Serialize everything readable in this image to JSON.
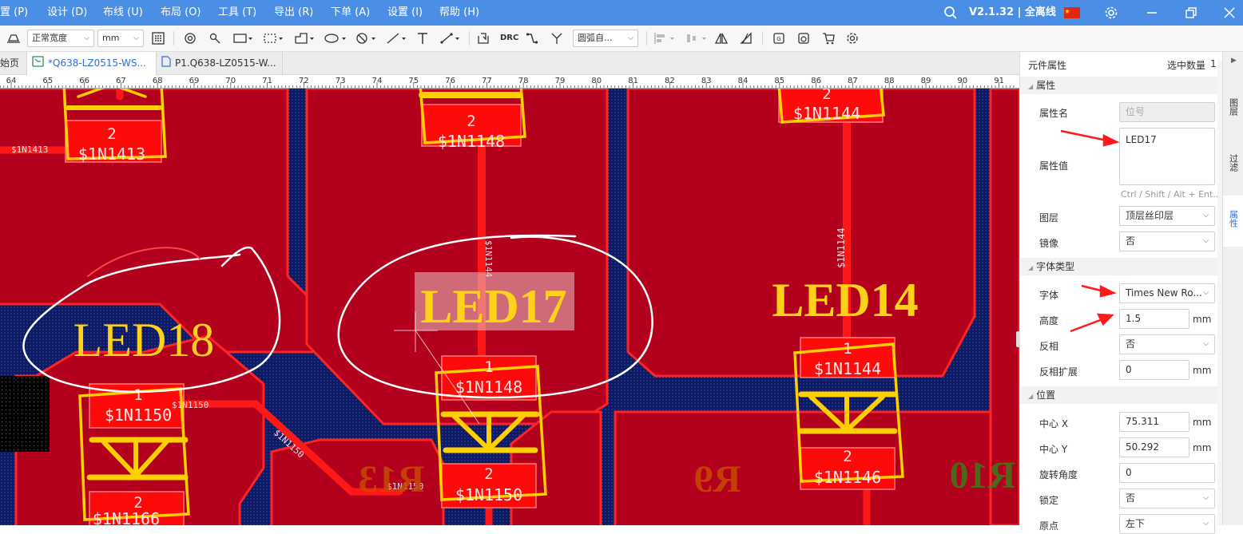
{
  "menubar": {
    "items": [
      "置 (P)",
      "设计 (D)",
      "布线 (U)",
      "布局 (O)",
      "工具 (T)",
      "导出 (R)",
      "下单 (A)",
      "设置 (I)",
      "帮助 (H)"
    ],
    "version": "V2.1.32 | 全离线"
  },
  "toolbar": {
    "line_width": "正常宽度",
    "unit": "mm",
    "arc_mode": "圆弧自...",
    "drc": "DRC"
  },
  "tabs": [
    {
      "label": "始页"
    },
    {
      "label": "*Q638-LZ0515-WS..."
    },
    {
      "label": "P1.Q638-LZ0515-W..."
    }
  ],
  "ruler": {
    "ticks": [
      "64",
      "65",
      "66",
      "67",
      "68",
      "69",
      "70",
      "71",
      "72",
      "73",
      "74",
      "75",
      "76",
      "77",
      "78",
      "79",
      "80",
      "81",
      "82",
      "83",
      "84",
      "85",
      "86",
      "87",
      "88",
      "89",
      "90",
      "91"
    ]
  },
  "pcb": {
    "silk_labels": [
      "LED18",
      "LED17",
      "LED14",
      "R13",
      "R9",
      "R10"
    ],
    "pads": [
      {
        "num": "2",
        "net": "$1N1413"
      },
      {
        "num": "2",
        "net": "$1N1148"
      },
      {
        "num": "2",
        "net": "$1N1144"
      },
      {
        "num": "1",
        "net": "$1N1150"
      },
      {
        "num": "2",
        "net": "$1N1166"
      },
      {
        "num": "1",
        "net": "$1N1148"
      },
      {
        "num": "2",
        "net": "$1N1150"
      },
      {
        "num": "1",
        "net": "$1N1144"
      },
      {
        "num": "2",
        "net": "$1N1146"
      }
    ],
    "nets": [
      "$1N1413",
      "$1N1150",
      "$1N1150",
      "$1N1150",
      "$1N1144",
      "$1N1144"
    ]
  },
  "panel": {
    "title": "元件属性",
    "selected_label": "选中数量",
    "selected_count": "1",
    "section_attr": "属性",
    "attr_name_label": "属性名",
    "attr_name_value": "位号",
    "attr_value_label": "属性值",
    "attr_value": "LED17",
    "attr_hint": "Ctrl / Shift / Alt + Ent...",
    "layer_label": "图层",
    "layer_value": "顶层丝印层",
    "mirror_label": "镜像",
    "mirror_value": "否",
    "section_font": "字体类型",
    "font_label": "字体",
    "font_value": "Times New Ro...",
    "height_label": "高度",
    "height_value": "1.5",
    "invert_label": "反相",
    "invert_value": "否",
    "invert_ext_label": "反相扩展",
    "invert_ext_value": "0",
    "section_pos": "位置",
    "cx_label": "中心 X",
    "cx_value": "75.311",
    "cy_label": "中心 Y",
    "cy_value": "50.292",
    "rot_label": "旋转角度",
    "rot_value": "0",
    "lock_label": "锁定",
    "lock_value": "否",
    "origin_label": "原点",
    "origin_value": "左下",
    "unit": "mm"
  },
  "side_tabs": [
    "图层",
    "过滤",
    "属性"
  ],
  "colors": {
    "menubar": "#4a8ee6",
    "copper": "#b2001d",
    "board": "#0c1a66",
    "track": "#ff1a1a",
    "silk": "#ffd700"
  }
}
